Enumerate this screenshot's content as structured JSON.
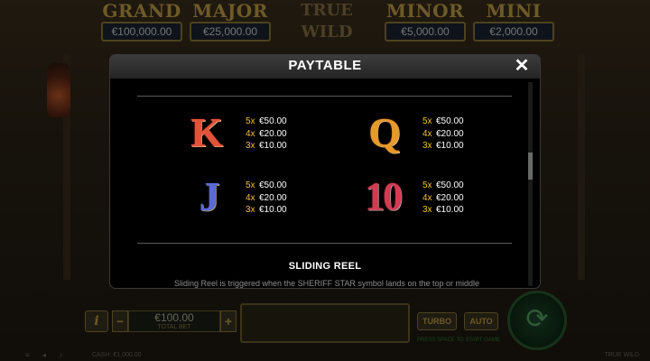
{
  "jackpots": [
    {
      "title": "GRAND",
      "value": "€100,000.00"
    },
    {
      "title": "MAJOR",
      "value": "€25,000.00"
    },
    {
      "title": "MINOR",
      "value": "€5,000.00"
    },
    {
      "title": "MINI",
      "value": "€2,000.00"
    }
  ],
  "game_logo": {
    "line1": "TRUE",
    "line2": "WILD"
  },
  "paytable": {
    "title": "PAYTABLE",
    "close_icon": "✕",
    "symbols": [
      {
        "name": "K",
        "pays": [
          {
            "mult": "5x",
            "amount": "€50.00"
          },
          {
            "mult": "4x",
            "amount": "€20.00"
          },
          {
            "mult": "3x",
            "amount": "€10.00"
          }
        ]
      },
      {
        "name": "Q",
        "pays": [
          {
            "mult": "5x",
            "amount": "€50.00"
          },
          {
            "mult": "4x",
            "amount": "€20.00"
          },
          {
            "mult": "3x",
            "amount": "€10.00"
          }
        ]
      },
      {
        "name": "J",
        "pays": [
          {
            "mult": "5x",
            "amount": "€50.00"
          },
          {
            "mult": "4x",
            "amount": "€20.00"
          },
          {
            "mult": "3x",
            "amount": "€10.00"
          }
        ]
      },
      {
        "name": "10",
        "pays": [
          {
            "mult": "5x",
            "amount": "€50.00"
          },
          {
            "mult": "4x",
            "amount": "€20.00"
          },
          {
            "mult": "3x",
            "amount": "€10.00"
          }
        ]
      }
    ],
    "section_heading": "SLIDING REEL",
    "section_text": "Sliding Reel is triggered when the SHERIFF STAR symbol lands on the top or middle"
  },
  "controls": {
    "info_label": "i",
    "bet_minus": "−",
    "bet_plus": "+",
    "bet_value": "€100.00",
    "bet_label": "TOTAL BET",
    "turbo_label": "TURBO",
    "auto_label": "AUTO",
    "spin_icon": "⟳",
    "hint": "PRESS SPACE TO START GAME"
  },
  "footer": {
    "cash": "CASH: €1,000.00",
    "game_name": "TRUE WILD",
    "icons": "≡ ◂ ♪"
  },
  "colors": {
    "multiplier": "#f2c02e",
    "jackpot_title": "#c9a449",
    "modal_bg": "#000000"
  }
}
